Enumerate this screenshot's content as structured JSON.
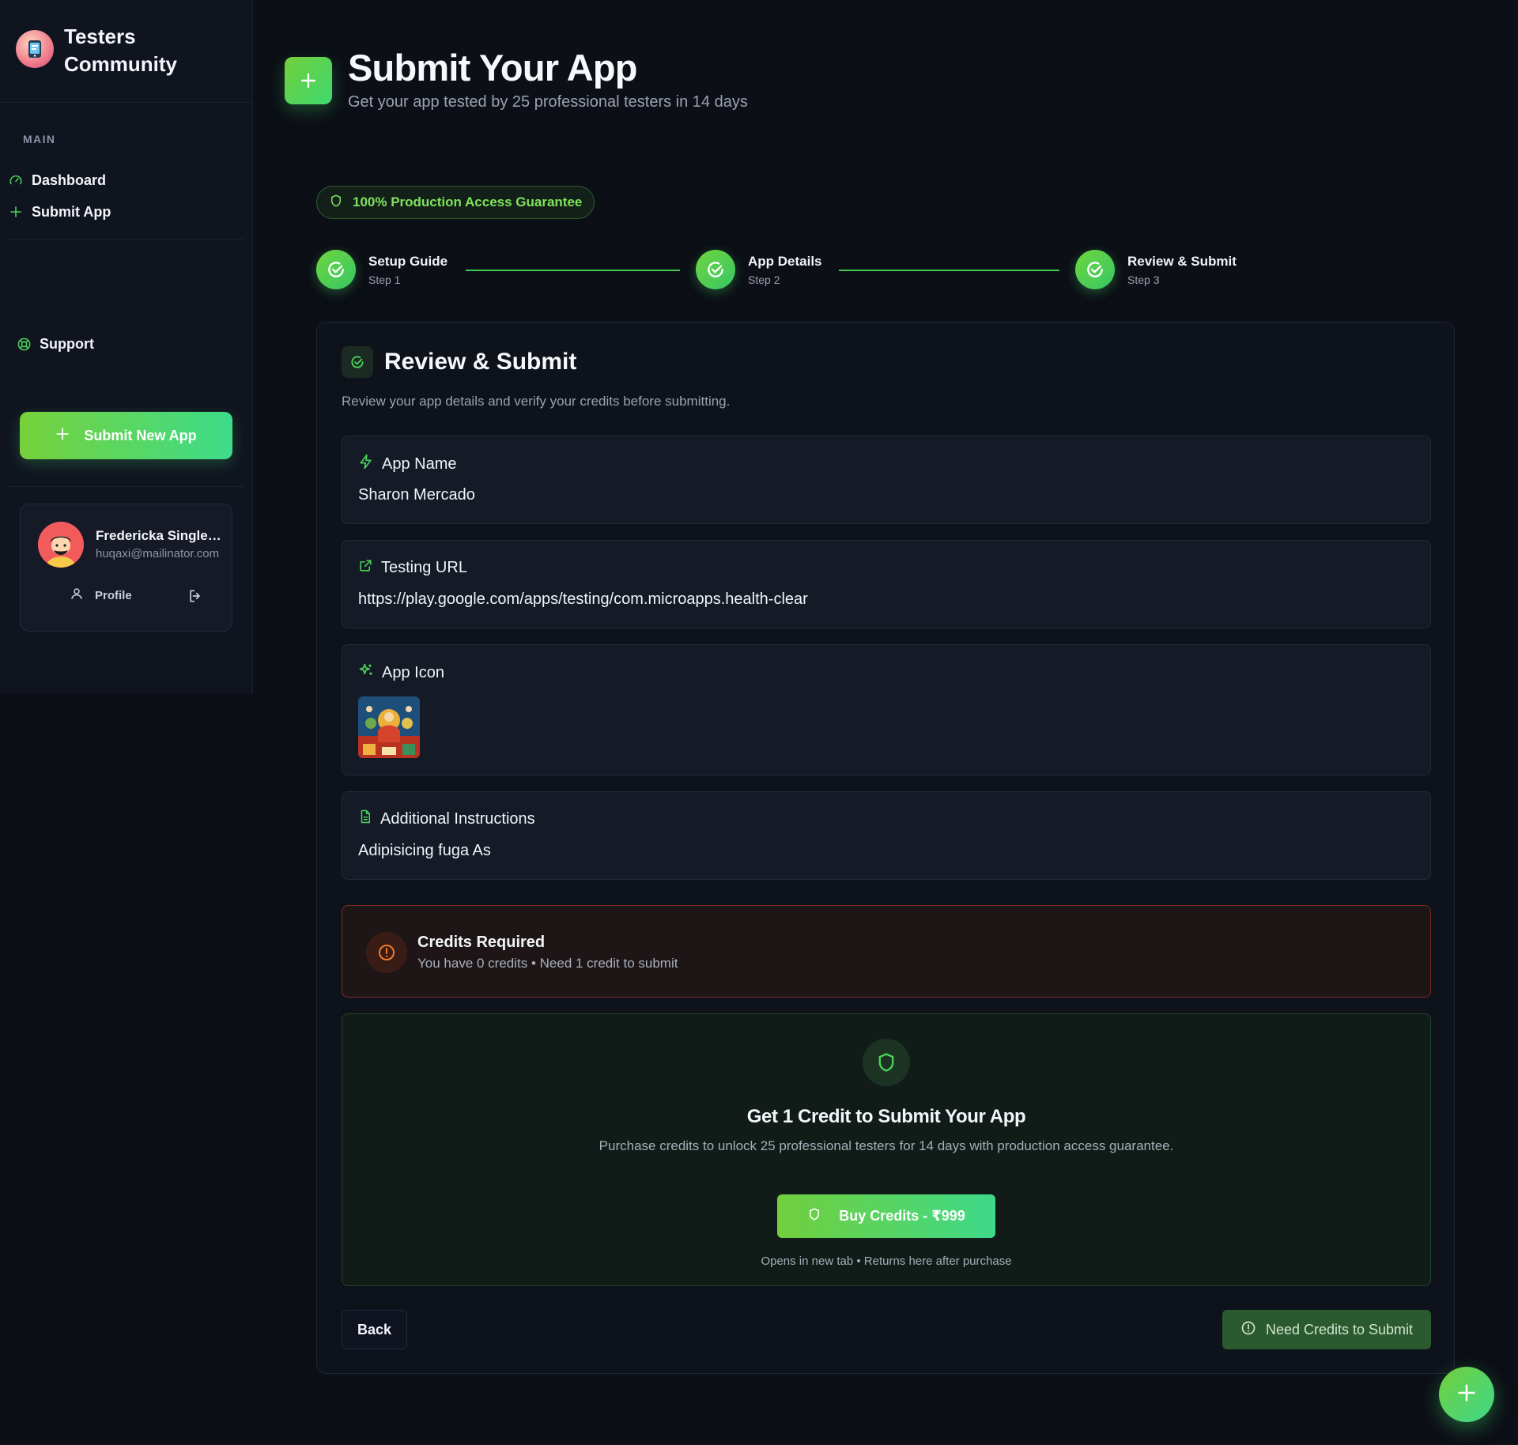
{
  "sidebar": {
    "brand": "Testers Community",
    "section_main": "MAIN",
    "items": [
      {
        "label": "Dashboard",
        "icon": "gauge-icon"
      },
      {
        "label": "Submit App",
        "icon": "plus-icon"
      }
    ],
    "support_label": "Support",
    "submit_new_label": "Submit New App",
    "user": {
      "name": "Fredericka Singleton",
      "email": "huqaxi@mailinator.com",
      "profile_label": "Profile"
    }
  },
  "header": {
    "title": "Submit Your App",
    "subtitle": "Get your app tested by 25 professional testers in 14 days"
  },
  "guarantee_badge": "100% Production Access Guarantee",
  "steps": [
    {
      "name": "Setup Guide",
      "sub": "Step 1",
      "status": "complete"
    },
    {
      "name": "App Details",
      "sub": "Step 2",
      "status": "complete"
    },
    {
      "name": "Review & Submit",
      "sub": "Step 3",
      "status": "complete"
    }
  ],
  "review": {
    "title": "Review & Submit",
    "description": "Review your app details and verify your credits before submitting.",
    "fields": {
      "app_name": {
        "label": "App Name",
        "value": "Sharon Mercado"
      },
      "testing_url": {
        "label": "Testing URL",
        "value": "https://play.google.com/apps/testing/com.microapps.health-clear"
      },
      "app_icon": {
        "label": "App Icon"
      },
      "instructions": {
        "label": "Additional Instructions",
        "value": "Adipisicing fuga As"
      }
    }
  },
  "credits_required": {
    "title": "Credits Required",
    "subtitle": "You have 0 credits • Need 1 credit to submit"
  },
  "buy": {
    "title": "Get 1 Credit to Submit Your App",
    "description": "Purchase credits to unlock 25 professional testers for 14 days with production access guarantee.",
    "button": "Buy Credits - ₹999",
    "note": "Opens in new tab • Returns here after purchase"
  },
  "actions": {
    "back": "Back",
    "need_credits": "Need Credits to Submit"
  },
  "colors": {
    "accent": "#4ad35a",
    "background": "#0c0f16",
    "warning_border": "#7a2a22",
    "warning_icon": "#f07a2a"
  }
}
